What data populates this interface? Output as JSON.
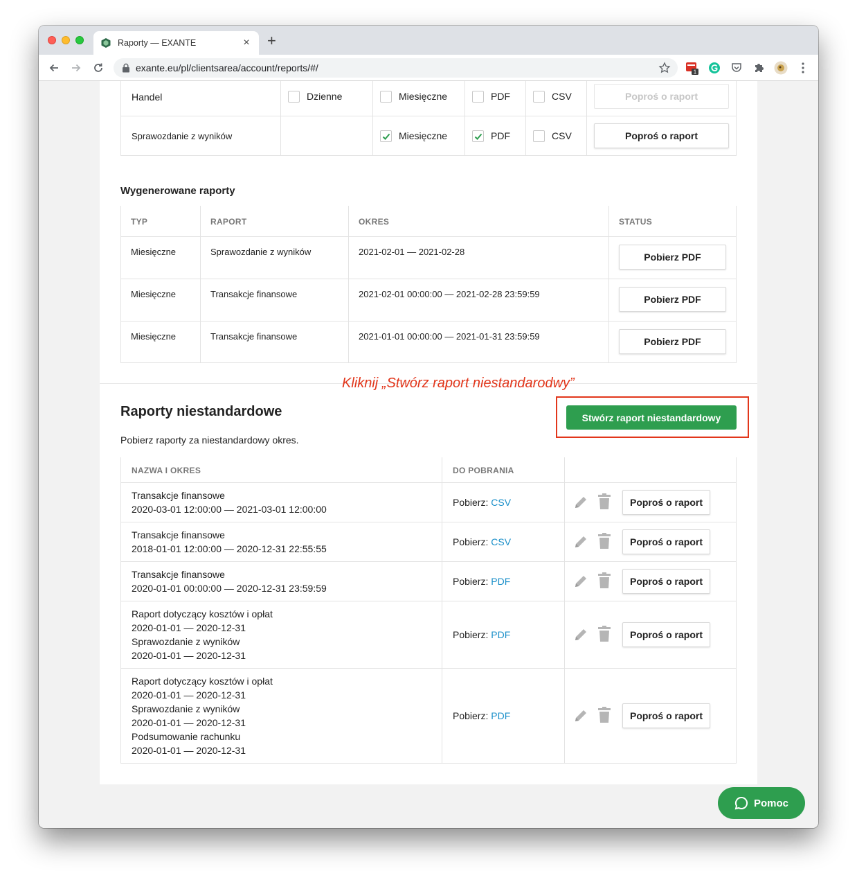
{
  "browser": {
    "tab_title": "Raporty — EXANTE",
    "tab_close": "×",
    "new_tab": "+",
    "url": "exante.eu/pl/clientsarea/account/reports/#/",
    "ext_badge": "1"
  },
  "top_rows": [
    {
      "name": "Handel",
      "daily": "Dzienne",
      "monthly": "Miesięczne",
      "pdf": "PDF",
      "csv": "CSV",
      "button": "Poproś o raport",
      "monthly_checked": false,
      "pdf_checked": false,
      "csv_checked": false,
      "button_disabled": true
    },
    {
      "name": "Sprawozdanie z wyników",
      "monthly": "Miesięczne",
      "pdf": "PDF",
      "csv": "CSV",
      "button": "Poproś o raport",
      "monthly_checked": true,
      "pdf_checked": true,
      "csv_checked": false,
      "button_disabled": false
    }
  ],
  "generated": {
    "title": "Wygenerowane raporty",
    "headers": [
      "TYP",
      "RAPORT",
      "OKRES",
      "STATUS"
    ],
    "rows": [
      {
        "type": "Miesięczne",
        "report": "Sprawozdanie z wyników",
        "period": "2021-02-01 — 2021-02-28",
        "status": "Pobierz PDF"
      },
      {
        "type": "Miesięczne",
        "report": "Transakcje finansowe",
        "period": "2021-02-01 00:00:00 — 2021-02-28 23:59:59",
        "status": "Pobierz PDF"
      },
      {
        "type": "Miesięczne",
        "report": "Transakcje finansowe",
        "period": "2021-01-01 00:00:00 — 2021-01-31 23:59:59",
        "status": "Pobierz PDF"
      }
    ]
  },
  "annotation": "Kliknij „Stwórz raport niestandarodwy”",
  "custom": {
    "title": "Raporty niestandardowe",
    "create_button": "Stwórz raport niestandardowy",
    "subtitle": "Pobierz raporty za niestandardowy okres.",
    "headers": [
      "NAZWA I OKRES",
      "DO POBRANIA"
    ],
    "download_prefix": "Pobierz:",
    "request_button": "Poproś o raport",
    "rows": [
      {
        "lines": [
          "Transakcje finansowe",
          "2020-03-01 12:00:00 — 2021-03-01 12:00:00"
        ],
        "format": "CSV"
      },
      {
        "lines": [
          "Transakcje finansowe",
          "2018-01-01 12:00:00 — 2020-12-31 22:55:55"
        ],
        "format": "CSV"
      },
      {
        "lines": [
          "Transakcje finansowe",
          "2020-01-01 00:00:00 — 2020-12-31 23:59:59"
        ],
        "format": "PDF"
      },
      {
        "lines": [
          "Raport dotyczący kosztów i opłat",
          "2020-01-01 — 2020-12-31",
          "Sprawozdanie z wyników",
          "2020-01-01 — 2020-12-31"
        ],
        "format": "PDF"
      },
      {
        "lines": [
          "Raport dotyczący kosztów i opłat",
          "2020-01-01 — 2020-12-31",
          "Sprawozdanie z wyników",
          "2020-01-01 — 2020-12-31",
          "Podsumowanie rachunku",
          "2020-01-01 — 2020-12-31"
        ],
        "format": "PDF"
      }
    ]
  },
  "help_button": "Pomoc",
  "colors": {
    "accent_green": "#2e9e4f",
    "link_blue": "#1a8fc9",
    "annotation_red": "#e2361b"
  }
}
